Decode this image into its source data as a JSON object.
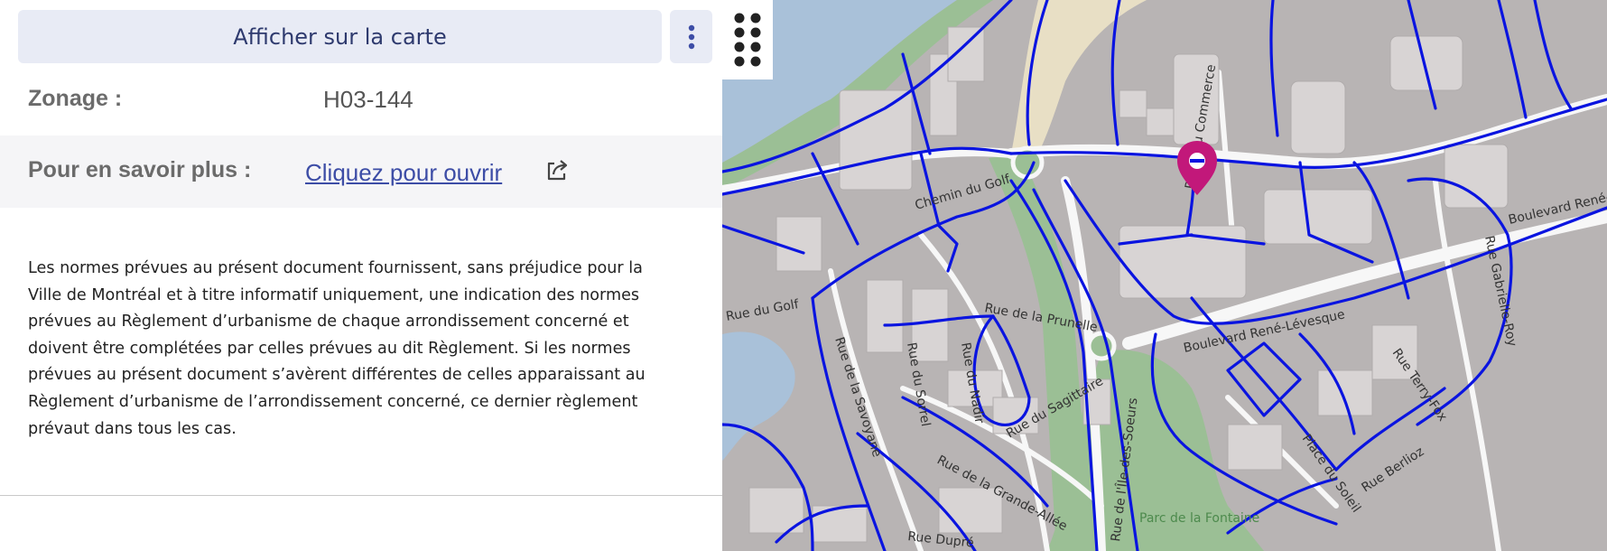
{
  "panel": {
    "show_map_label": "Afficher sur la carte",
    "zonage_label": "Zonage :",
    "zonage_value": "H03-144",
    "more_label": "Pour en savoir plus :",
    "open_link_label": "Cliquez pour ouvrir",
    "disclaimer": "Les normes prévues au présent document fournissent, sans préjudice pour la Ville de Montréal et à titre informatif uniquement, une indication des normes prévues au Règlement d’urbanisme de chaque arrondissement concerné et doivent être complétées par celles prévues au dit Règlement. Si les normes prévues au présent document s’avèrent différentes de celles apparaissant au Règlement d’urbanisme de l’arrondissement concerné, ce dernier règlement prévaut dans tous les cas."
  },
  "map": {
    "streets": {
      "chemin_golf": "Chemin du Golf",
      "place_commerce": "Place du Commerce",
      "boul_rene_east": "Boulevard René-",
      "boul_rene": "Boulevard René-Lévesque",
      "rue_gabrielle_roy": "Rue Gabrielle-Roy",
      "rue_prunelle": "Rue de la Prunelle",
      "rue_sagittaire": "Rue du Sagittaire",
      "rue_savoyane": "Rue de la Savoyane",
      "rue_grande_allee": "Rue de la Grande-Allée",
      "rue_ile_soeurs": "Rue de l'Île-des-Soeurs",
      "rue_dupre": "Rue Dupré",
      "place_soleil": "Place du Soleil",
      "rue_berlioz": "Rue Berlioz",
      "rue_terry_fox": "Rue Terry-Fox",
      "rue_golf_west": "Rue du Golf",
      "rue_sorrel": "Rue du Sorrel",
      "rue_nadir": "Rue du Nadir"
    },
    "park": "Parc de la Fontaine"
  },
  "colors": {
    "zone_border": "#0a14e0",
    "marker": "#c2187a",
    "water": "#a9c1d9",
    "park": "#9bbf95"
  }
}
